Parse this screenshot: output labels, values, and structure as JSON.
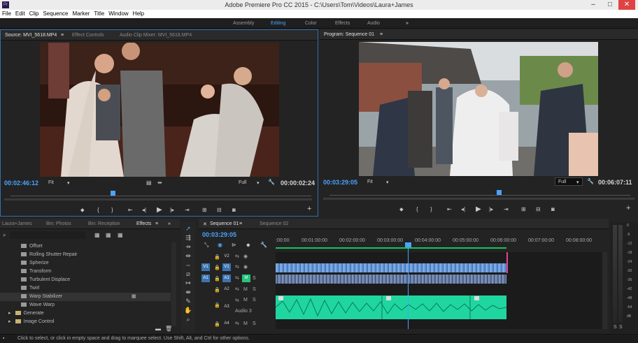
{
  "window": {
    "title": "Adobe Premiere Pro CC 2015 - C:\\Users\\Tom\\Videos\\Laura+James",
    "logo": "Pr"
  },
  "menu": [
    "File",
    "Edit",
    "Clip",
    "Sequence",
    "Marker",
    "Title",
    "Window",
    "Help"
  ],
  "workspaces": [
    "Assembly",
    "Editing",
    "Color",
    "Effects",
    "Audio"
  ],
  "workspace_active": "Editing",
  "source": {
    "tabs": [
      "Source: MVI_5618.MP4",
      "Effect Controls",
      "Audio Clip Mixer: MVI_5618.MP4"
    ],
    "timecode": "00:02:46:12",
    "fit": "Fit",
    "resolution": "Full",
    "duration": "00:00:02:24"
  },
  "program": {
    "tab": "Program: Sequence 01",
    "timecode": "00:03:29:05",
    "fit": "Fit",
    "resolution": "Full",
    "duration": "00:06:07:11"
  },
  "project": {
    "tabs": [
      "Laura+James",
      "Bin: Photos",
      "Bin: Reception",
      "Effects"
    ],
    "effects": [
      "Offset",
      "Rolling Shutter Repair",
      "Spherize",
      "Transform",
      "Turbulent Displace",
      "Twirl",
      "Warp Stabilizer",
      "Wave Warp"
    ],
    "folders": [
      "Generate",
      "Image Control"
    ]
  },
  "timeline": {
    "tabs": [
      "Sequence 01",
      "Sequence 02"
    ],
    "timecode": "00:03:29:05",
    "ruler": [
      ":00:00",
      "00:01:00:00",
      "00:02:00:00",
      "00:03:00:00",
      "00:04:00:00",
      "00:05:00:00",
      "00:06:00:00",
      "00:07:00:00",
      "00:08:00:00"
    ],
    "tracks": [
      {
        "src": "",
        "name": "V2",
        "kind": "v"
      },
      {
        "src": "V1",
        "name": "V1",
        "kind": "v"
      },
      {
        "src": "A1",
        "name": "A1",
        "kind": "a"
      },
      {
        "src": "",
        "name": "A2",
        "kind": "a"
      },
      {
        "src": "",
        "name": "A3",
        "kind": "a"
      },
      {
        "src": "",
        "name": "A4",
        "kind": "a"
      }
    ],
    "audio3_label": "Audio 3",
    "m": "M",
    "s": "S"
  },
  "meter": {
    "labels": [
      "0",
      "-6",
      "-12",
      "-18",
      "-24",
      "-30",
      "-36",
      "-42",
      "-48",
      "-54",
      "dB"
    ],
    "solo": [
      "S",
      "S"
    ]
  },
  "status": "Click to select, or click in empty space and drag to marquee select. Use Shift, Alt, and Ctrl for other options.",
  "colors": {
    "accent": "#4aa3ff",
    "audio_clip": "#1fd6a0",
    "video_clip": "#5a8fd1",
    "playhead": "#4aa3ff"
  }
}
